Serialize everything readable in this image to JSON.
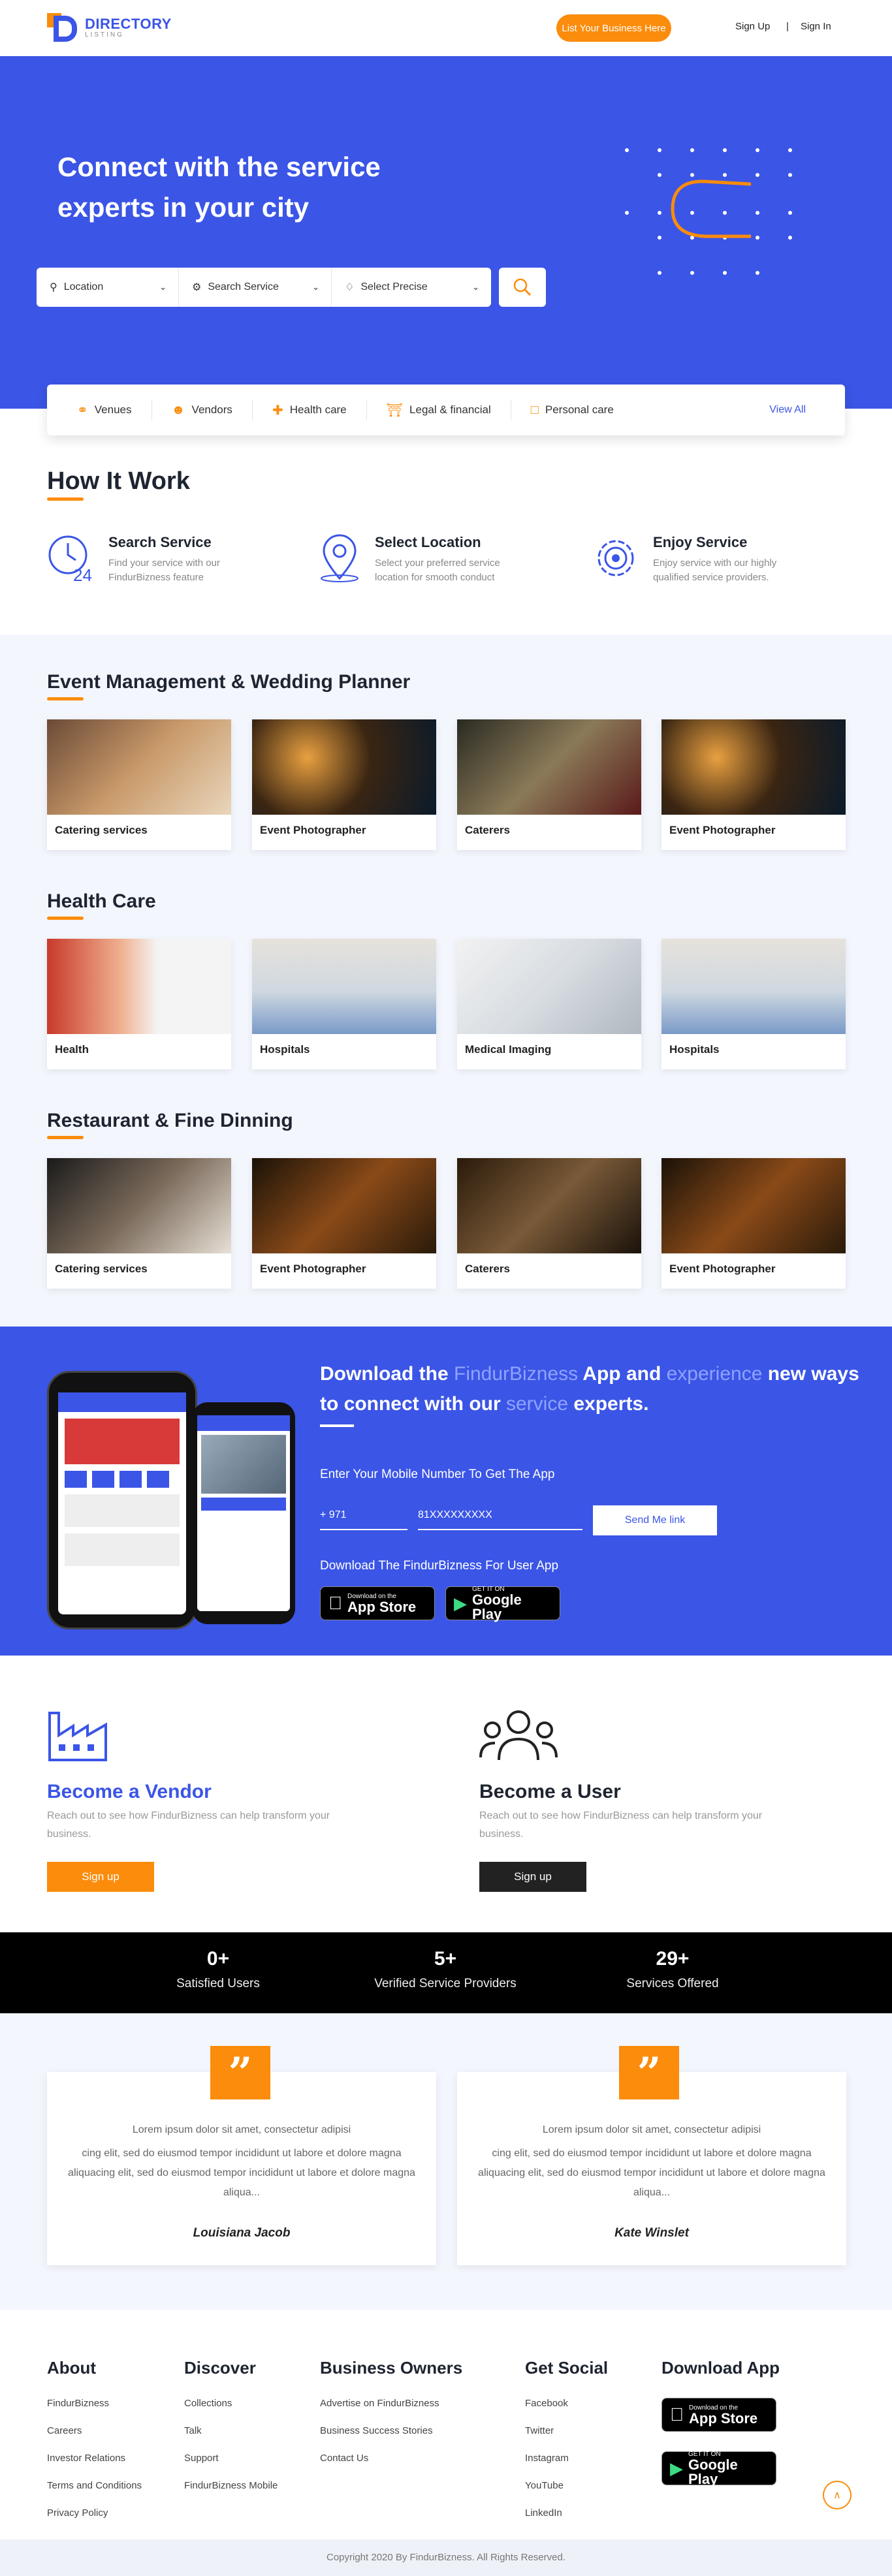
{
  "header": {
    "logo_title": "DIRECTORY",
    "logo_sub": "LISTING",
    "list_business": "List Your Business Here",
    "sign_up": "Sign Up",
    "separator": "|",
    "sign_in": "Sign In"
  },
  "hero": {
    "title": "Connect with the service experts in your city",
    "location": "Location",
    "service": "Search Service",
    "precise": "Select Precise"
  },
  "categories": {
    "items": [
      "Venues",
      "Vendors",
      "Health care",
      "Legal & financial",
      "Personal care"
    ],
    "view_all": "View All"
  },
  "how": {
    "title": "How It Work",
    "steps": [
      {
        "title": "Search Service",
        "desc": "Find your service with our FindurBizness feature"
      },
      {
        "title": "Select Location",
        "desc": "Select your preferred service location for smooth conduct"
      },
      {
        "title": "Enjoy Service",
        "desc": "Enjoy service with our highly qualified service providers."
      }
    ]
  },
  "sections": [
    {
      "title": "Event Management & Wedding Planner",
      "cards": [
        "Catering services",
        "Event Photographer",
        "Caterers",
        "Event Photographer"
      ]
    },
    {
      "title": "Health Care",
      "cards": [
        "Health",
        "Hospitals",
        "Medical Imaging",
        "Hospitals"
      ]
    },
    {
      "title": "Restaurant & Fine Dinning",
      "cards": [
        "Catering services",
        "Event Photographer",
        "Caterers",
        "Event Photographer"
      ]
    }
  ],
  "download": {
    "t1": "Download the ",
    "t2": "FindurBizness",
    "t3": " App and ",
    "t4": "experience",
    "t5": " new ways to connect with our ",
    "t6": "service",
    "t7": " experts.",
    "mobile_label": "Enter Your Mobile Number To Get The App",
    "code": "+ 971",
    "number": "81XXXXXXXXX",
    "send": "Send Me link",
    "app_label": "Download The FindurBizness For User App",
    "appstore_small": "Download on the",
    "appstore": "App Store",
    "gplay_small": "GET IT ON",
    "gplay": "Google Play"
  },
  "vendor": {
    "title": "Become a Vendor",
    "desc": "Reach out to see how FindurBizness can help transform your business.",
    "button": "Sign up"
  },
  "user": {
    "title": "Become a User",
    "desc": "Reach out to see how FindurBizness can help transform your business.",
    "button": "Sign up"
  },
  "stats": [
    {
      "n": "0+",
      "l": "Satisfied Users"
    },
    {
      "n": "5+",
      "l": "Verified Service Providers"
    },
    {
      "n": "29+",
      "l": "Services Offered"
    }
  ],
  "testimonials": [
    {
      "l1": "Lorem ipsum dolor sit amet, consectetur adipisi",
      "l2": "cing elit, sed do eiusmod tempor incididunt ut labore et dolore magna aliquacing elit, sed do eiusmod tempor incididunt ut labore et dolore magna aliqua...",
      "name": "Louisiana Jacob"
    },
    {
      "l1": "Lorem ipsum dolor sit amet, consectetur adipisi",
      "l2": "cing elit, sed do eiusmod tempor incididunt ut labore et dolore magna aliquacing elit, sed do eiusmod tempor incididunt ut labore et dolore magna aliqua...",
      "name": "Kate Winslet"
    }
  ],
  "footer": {
    "about": {
      "title": "About",
      "links": [
        "FindurBizness",
        "Careers",
        "Investor Relations",
        "Terms and Conditions",
        "Privacy Policy"
      ]
    },
    "discover": {
      "title": "Discover",
      "links": [
        "Collections",
        "Talk",
        "Support",
        "FindurBizness Mobile"
      ]
    },
    "owners": {
      "title": "Business Owners",
      "links": [
        "Advertise on FindurBizness",
        "Business Success Stories",
        "Contact Us"
      ]
    },
    "social": {
      "title": "Get Social",
      "links": [
        "Facebook",
        "Twitter",
        "Instagram",
        "YouTube",
        "LinkedIn"
      ]
    },
    "app": {
      "title": "Download App"
    },
    "copyright": "Copyright 2020 By FindurBizness. All Rights Reserved."
  },
  "colors": {
    "brand": "#3b55e6",
    "accent": "#fb8c0c",
    "dark": "#1e2430"
  }
}
